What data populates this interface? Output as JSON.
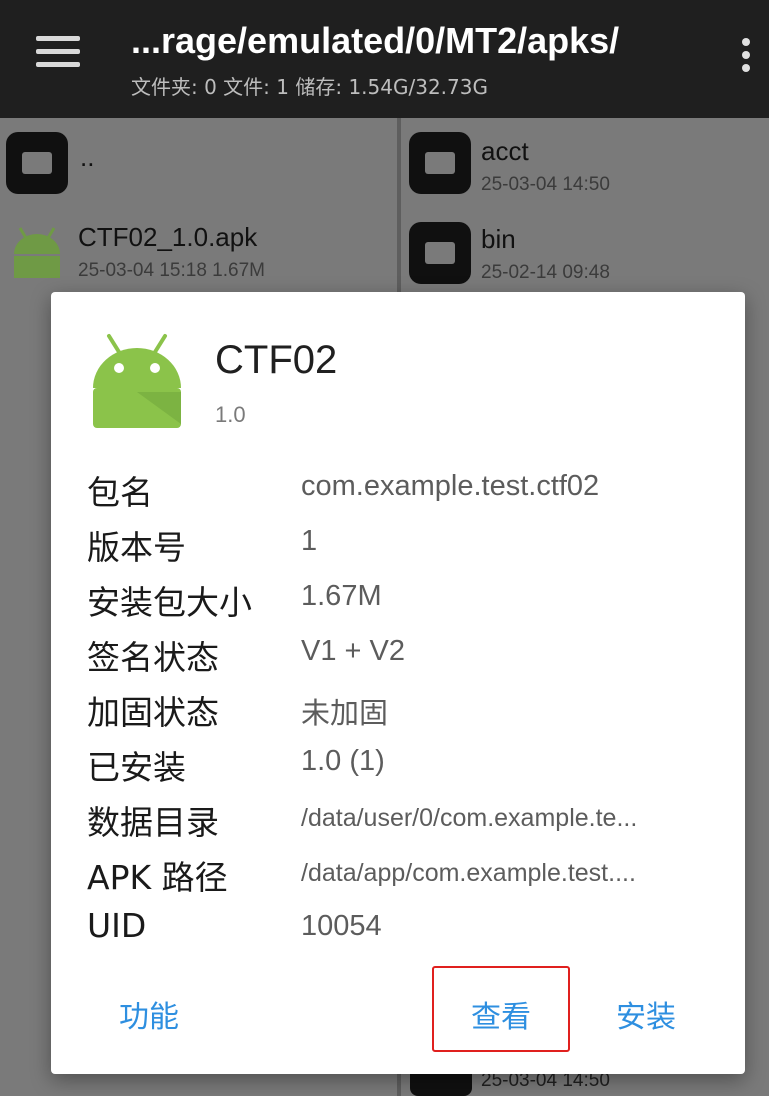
{
  "appbar": {
    "path": "...rage/emulated/0/MT2/apks/",
    "stats": "文件夹: 0  文件: 1  储存: 1.54G/32.73G"
  },
  "left_pane": {
    "items": [
      {
        "name": "..",
        "meta": "",
        "icon": "folder-icon"
      },
      {
        "name": "CTF02_1.0.apk",
        "meta": "25-03-04 15:18  1.67M",
        "icon": "android-icon"
      }
    ]
  },
  "right_pane": {
    "items": [
      {
        "name": "acct",
        "meta": "25-03-04 14:50",
        "icon": "folder-icon"
      },
      {
        "name": "bin",
        "meta": "25-02-14 09:48",
        "icon": "folder-icon"
      }
    ],
    "bottom_meta": "25-03-04 14:50"
  },
  "dialog": {
    "app_name": "CTF02",
    "app_version": "1.0",
    "rows": [
      {
        "label": "包名",
        "value": "com.example.test.ctf02"
      },
      {
        "label": "版本号",
        "value": "1"
      },
      {
        "label": "安装包大小",
        "value": "1.67M"
      },
      {
        "label": "签名状态",
        "value": "V1 + V2"
      },
      {
        "label": "加固状态",
        "value": "未加固"
      },
      {
        "label": "已安装",
        "value": "1.0 (1)"
      },
      {
        "label": "数据目录",
        "value": "/data/user/0/com.example.te..."
      },
      {
        "label": "APK 路径",
        "value": "/data/app/com.example.test...."
      },
      {
        "label": "UID",
        "value": "10054"
      }
    ],
    "buttons": {
      "functions": "功能",
      "view": "查看",
      "install": "安装"
    },
    "accent_color": "#2e8fe0",
    "highlight_color": "#e0201e"
  }
}
